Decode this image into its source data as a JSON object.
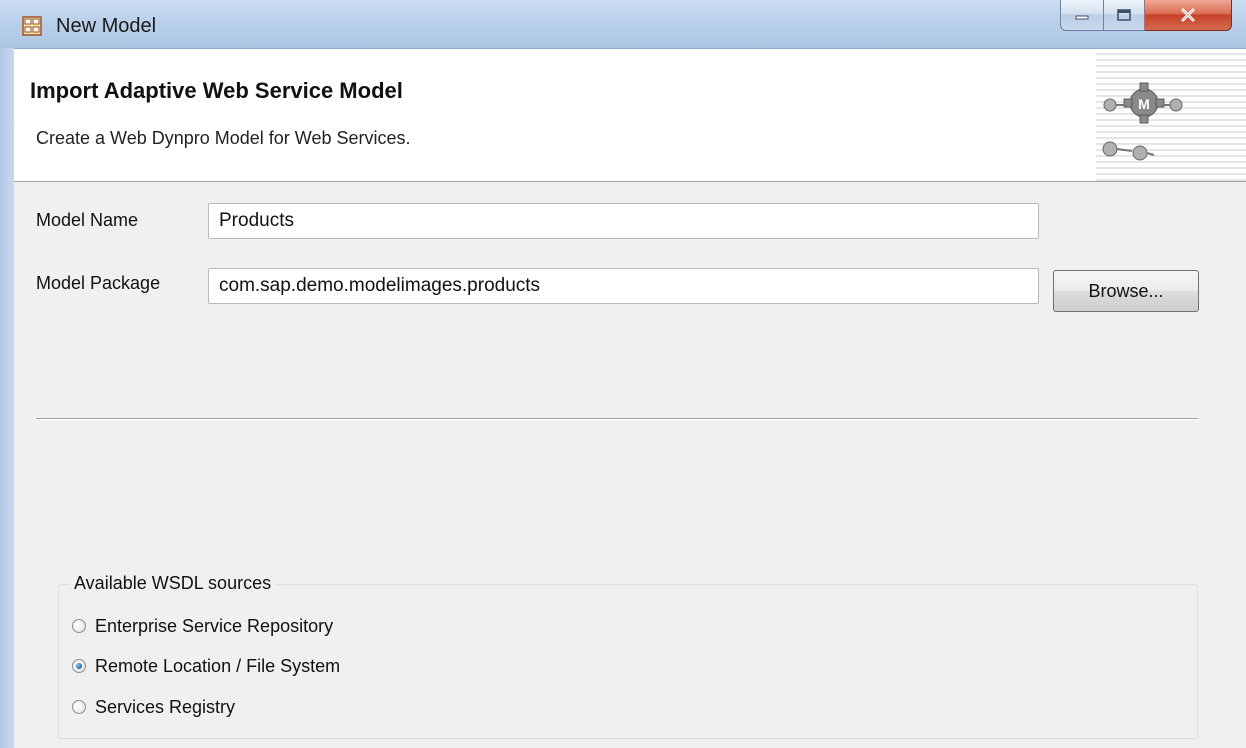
{
  "window": {
    "title": "New Model",
    "minimize_glyph": "—",
    "maximize_glyph": "□",
    "close_glyph": "X"
  },
  "header": {
    "title": "Import Adaptive Web Service Model",
    "description": "Create a Web Dynpro Model for Web Services."
  },
  "form": {
    "model_name_label": "Model Name",
    "model_name_value": "Products",
    "model_package_label": "Model Package",
    "model_package_value": "com.sap.demo.modelimages.products",
    "browse_label": "Browse..."
  },
  "wsdl_sources": {
    "group_label": "Available WSDL sources",
    "options": [
      {
        "label": "Enterprise Service Repository",
        "selected": false
      },
      {
        "label": "Remote Location / File System",
        "selected": true
      },
      {
        "label": "Services Registry",
        "selected": false
      }
    ]
  },
  "colors": {
    "titlebar": "#bad0ea",
    "close_button": "#c7422a",
    "dialog_background": "#f0f0f0",
    "header_background": "#ffffff"
  },
  "icons": {
    "app": "wizard-window-icon",
    "wizard_banner": "web-dynpro-model-gears-icon"
  }
}
